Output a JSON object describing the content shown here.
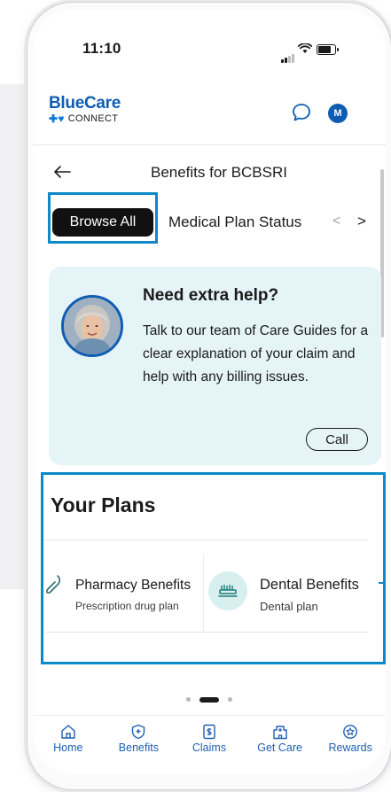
{
  "status_bar": {
    "time": "11:10",
    "battery_level": 0.85
  },
  "header": {
    "logo_brand": "BlueCare",
    "logo_sub": "CONNECT",
    "avatar_initial": "M"
  },
  "page": {
    "title": "Benefits for BCBSRI"
  },
  "tabs": {
    "browse_all": "Browse All",
    "medical_plan_status": "Medical Plan Status",
    "prev_label": "<",
    "next_label": ">"
  },
  "help_card": {
    "title": "Need extra help?",
    "body": "Talk to our team of Care Guides for a clear explanation of your claim and help with any billing issues.",
    "call_label": "Call"
  },
  "plans": {
    "title": "Your Plans",
    "items": [
      {
        "name": "Pharmacy Benefits",
        "subtitle": "Prescription drug plan"
      },
      {
        "name": "Dental Benefits",
        "subtitle": "Dental plan"
      }
    ],
    "carousel_pages": 3,
    "carousel_active": 1
  },
  "bottom_nav": {
    "items": [
      {
        "label": "Home",
        "icon": "home-icon"
      },
      {
        "label": "Benefits",
        "icon": "shield-icon"
      },
      {
        "label": "Claims",
        "icon": "claims-icon"
      },
      {
        "label": "Get Care",
        "icon": "hospital-icon"
      },
      {
        "label": "Rewards",
        "icon": "rewards-icon"
      }
    ]
  },
  "colors": {
    "brand_blue": "#0f5db3",
    "highlight_border": "#0b8ac7",
    "help_card_bg": "#e5f4f7",
    "nav_blue": "#1f5fb3"
  }
}
